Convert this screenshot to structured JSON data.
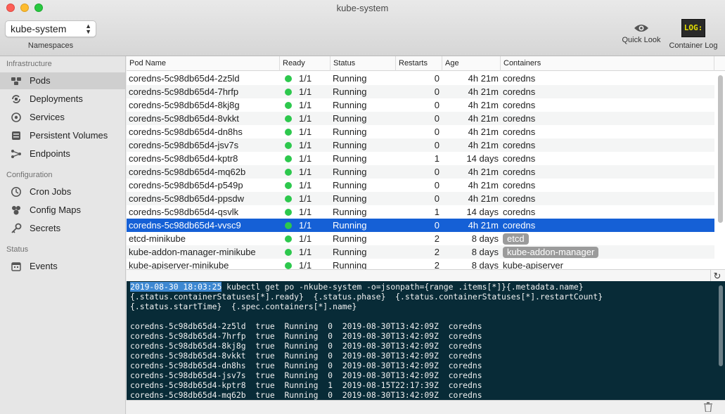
{
  "window": {
    "title": "kube-system"
  },
  "toolbar": {
    "namespace_value": "kube-system",
    "namespace_label": "Namespaces",
    "quick_look_label": "Quick Look",
    "container_log_label": "Container Log",
    "log_icon_text": "LOG:"
  },
  "sidebar": {
    "sections": [
      {
        "title": "Infrastructure",
        "items": [
          {
            "label": "Pods",
            "icon": "pods-icon"
          },
          {
            "label": "Deployments",
            "icon": "deployments-icon"
          },
          {
            "label": "Services",
            "icon": "services-icon"
          },
          {
            "label": "Persistent Volumes",
            "icon": "volumes-icon"
          },
          {
            "label": "Endpoints",
            "icon": "endpoints-icon"
          }
        ]
      },
      {
        "title": "Configuration",
        "items": [
          {
            "label": "Cron Jobs",
            "icon": "clock-icon"
          },
          {
            "label": "Config Maps",
            "icon": "config-maps-icon"
          },
          {
            "label": "Secrets",
            "icon": "key-icon"
          }
        ]
      },
      {
        "title": "Status",
        "items": [
          {
            "label": "Events",
            "icon": "calendar-icon"
          }
        ]
      }
    ],
    "selected": "Pods"
  },
  "table": {
    "columns": [
      "Pod Name",
      "Ready",
      "Status",
      "Restarts",
      "Age",
      "Containers"
    ],
    "rows": [
      {
        "name": "coredns-5c98db65d4-2z5ld",
        "ready": "1/1",
        "status": "Running",
        "restarts": "0",
        "age": "4h 21m",
        "containers": "coredns"
      },
      {
        "name": "coredns-5c98db65d4-7hrfp",
        "ready": "1/1",
        "status": "Running",
        "restarts": "0",
        "age": "4h 21m",
        "containers": "coredns"
      },
      {
        "name": "coredns-5c98db65d4-8kj8g",
        "ready": "1/1",
        "status": "Running",
        "restarts": "0",
        "age": "4h 21m",
        "containers": "coredns"
      },
      {
        "name": "coredns-5c98db65d4-8vkkt",
        "ready": "1/1",
        "status": "Running",
        "restarts": "0",
        "age": "4h 21m",
        "containers": "coredns"
      },
      {
        "name": "coredns-5c98db65d4-dn8hs",
        "ready": "1/1",
        "status": "Running",
        "restarts": "0",
        "age": "4h 21m",
        "containers": "coredns"
      },
      {
        "name": "coredns-5c98db65d4-jsv7s",
        "ready": "1/1",
        "status": "Running",
        "restarts": "0",
        "age": "4h 21m",
        "containers": "coredns"
      },
      {
        "name": "coredns-5c98db65d4-kptr8",
        "ready": "1/1",
        "status": "Running",
        "restarts": "1",
        "age": "14 days",
        "containers": "coredns"
      },
      {
        "name": "coredns-5c98db65d4-mq62b",
        "ready": "1/1",
        "status": "Running",
        "restarts": "0",
        "age": "4h 21m",
        "containers": "coredns"
      },
      {
        "name": "coredns-5c98db65d4-p549p",
        "ready": "1/1",
        "status": "Running",
        "restarts": "0",
        "age": "4h 21m",
        "containers": "coredns"
      },
      {
        "name": "coredns-5c98db65d4-ppsdw",
        "ready": "1/1",
        "status": "Running",
        "restarts": "0",
        "age": "4h 21m",
        "containers": "coredns"
      },
      {
        "name": "coredns-5c98db65d4-qsvlk",
        "ready": "1/1",
        "status": "Running",
        "restarts": "1",
        "age": "14 days",
        "containers": "coredns"
      },
      {
        "name": "coredns-5c98db65d4-vvsc9",
        "ready": "1/1",
        "status": "Running",
        "restarts": "0",
        "age": "4h 21m",
        "containers": "coredns",
        "selected": true
      },
      {
        "name": "etcd-minikube",
        "ready": "1/1",
        "status": "Running",
        "restarts": "2",
        "age": "8 days",
        "containers": "etcd",
        "badge": true
      },
      {
        "name": "kube-addon-manager-minikube",
        "ready": "1/1",
        "status": "Running",
        "restarts": "2",
        "age": "8 days",
        "containers": "kube-addon-manager",
        "badge": true
      },
      {
        "name": "kube-apiserver-minikube",
        "ready": "1/1",
        "status": "Running",
        "restarts": "2",
        "age": "8 days",
        "containers": "kube-apiserver"
      }
    ],
    "ready_dot_color": "#2dc84d",
    "selection_color": "#1560d6"
  },
  "terminal": {
    "timestamp": "2019-08-30 18:03:25",
    "command_lines": [
      " kubectl get po -nkube-system -o=jsonpath={range .items[*]}{.metadata.name}",
      "{.status.containerStatuses[*].ready}  {.status.phase}  {.status.containerStatuses[*].restartCount}",
      "{.status.startTime}  {.spec.containers[*].name}",
      ""
    ],
    "output_lines": [
      "coredns-5c98db65d4-2z5ld  true  Running  0  2019-08-30T13:42:09Z  coredns",
      "coredns-5c98db65d4-7hrfp  true  Running  0  2019-08-30T13:42:09Z  coredns",
      "coredns-5c98db65d4-8kj8g  true  Running  0  2019-08-30T13:42:09Z  coredns",
      "coredns-5c98db65d4-8vkkt  true  Running  0  2019-08-30T13:42:09Z  coredns",
      "coredns-5c98db65d4-dn8hs  true  Running  0  2019-08-30T13:42:09Z  coredns",
      "coredns-5c98db65d4-jsv7s  true  Running  0  2019-08-30T13:42:09Z  coredns",
      "coredns-5c98db65d4-kptr8  true  Running  1  2019-08-15T22:17:39Z  coredns",
      "coredns-5c98db65d4-mq62b  true  Running  0  2019-08-30T13:42:09Z  coredns"
    ],
    "background": "#082b37"
  }
}
